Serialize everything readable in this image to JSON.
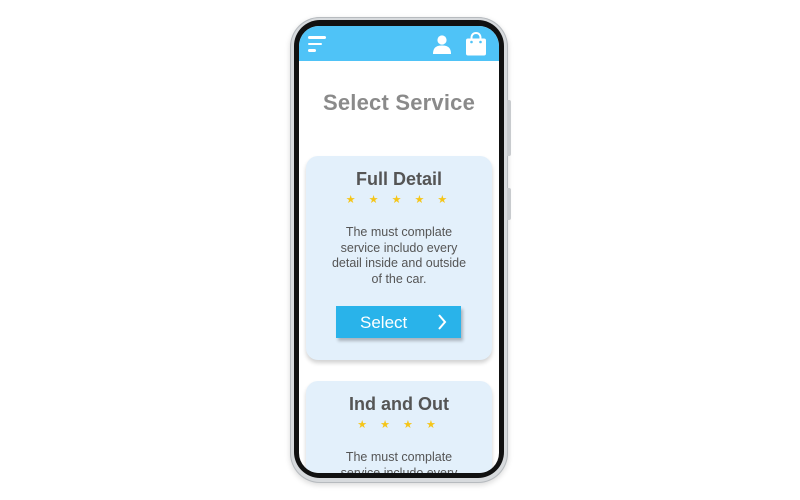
{
  "header": {
    "menu_icon": "menu-icon",
    "user_icon": "user-icon",
    "bag_icon": "shopping-bag-icon",
    "bar_color": "#4fc3f7"
  },
  "page": {
    "title": "Select Service"
  },
  "services": [
    {
      "name": "Full Detail",
      "stars": "★ ★ ★ ★ ★",
      "rating": 5,
      "description": "The must complate service includo every detail inside and outside of the car.",
      "button_label": "Select"
    },
    {
      "name": "Ind and Out",
      "stars": "★ ★ ★ ★",
      "rating": 4,
      "description": "The must complate service includo every"
    }
  ],
  "colors": {
    "card_bg": "#e3f0fb",
    "button_bg": "#29b3ea",
    "star": "#f5c518"
  }
}
